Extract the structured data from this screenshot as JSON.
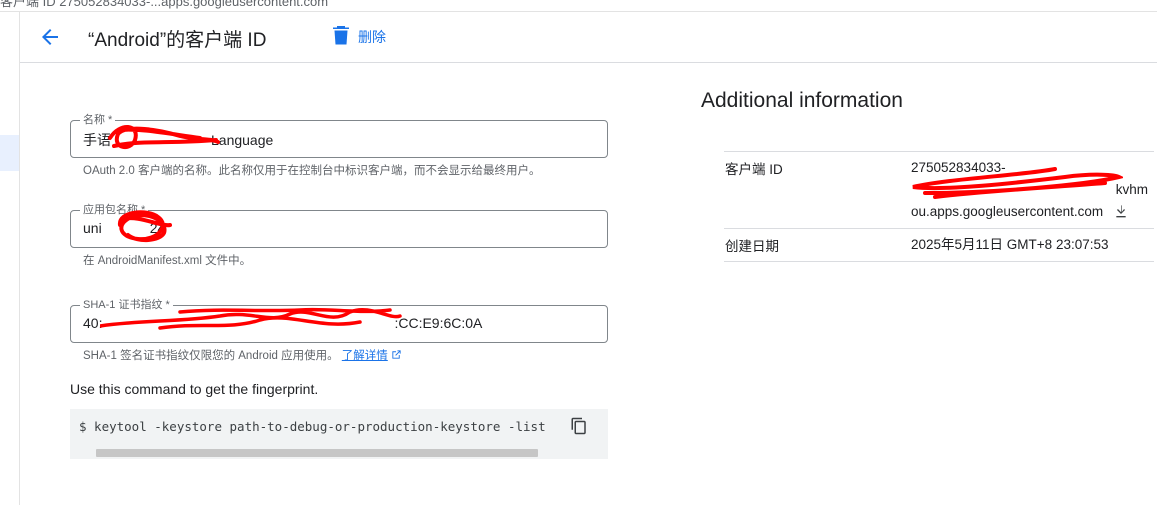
{
  "browser": {
    "url_strip": "客户端 ID 275052834033-...apps.googleusercontent.com"
  },
  "header": {
    "title": "“Android”的客户端 ID",
    "delete_label": "删除"
  },
  "form": {
    "name": {
      "label": "名称 *",
      "value_start": "手语",
      "value_end": "Language",
      "hint": "OAuth 2.0 客户端的名称。此名称仅用于在控制台中标识客户端，而不会显示给最终用户。"
    },
    "package": {
      "label": "应用包名称 *",
      "value_start": "uni",
      "value_end": "24",
      "hint": "在 AndroidManifest.xml 文件中。"
    },
    "sha1": {
      "label": "SHA-1 证书指纹 *",
      "value_start": "40:",
      "value_end": ":CC:E9:6C:0A",
      "hint": "SHA-1 签名证书指纹仅限您的 Android 应用使用。",
      "learn_more": "了解详情"
    }
  },
  "command": {
    "note": "Use this command to get the fingerprint.",
    "code": "$ keytool -keystore path-to-debug-or-production-keystore -list"
  },
  "additional": {
    "title": "Additional information",
    "client_id_label": "客户端 ID",
    "client_id_line1": "275052834033-",
    "client_id_line2_end": "kvhm",
    "client_id_line3": "ou.apps.googleusercontent.com",
    "created_label": "创建日期",
    "created_value": "2025年5月11日 GMT+8 23:07:53"
  }
}
